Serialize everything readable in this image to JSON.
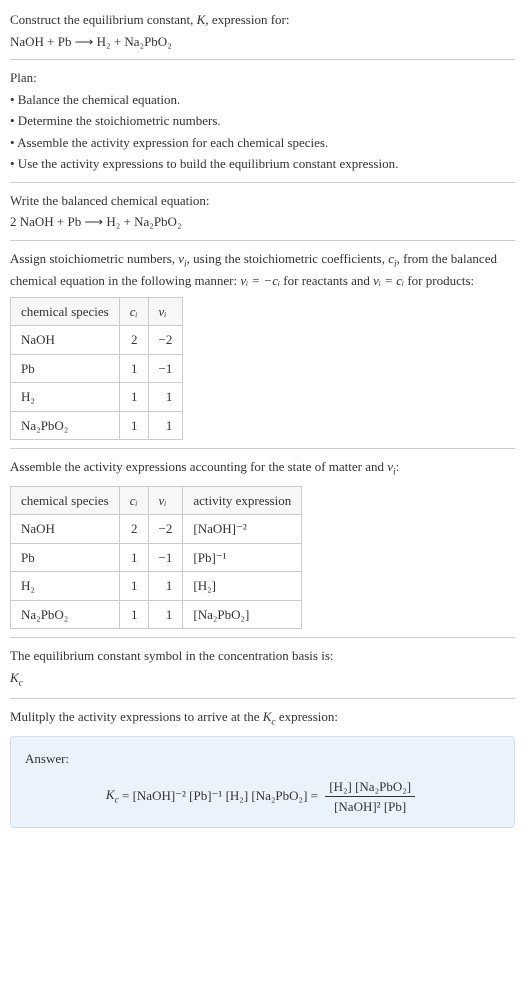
{
  "header": {
    "line1_prefix": "Construct the equilibrium constant, ",
    "line1_K": "K",
    "line1_suffix": ", expression for:",
    "equation": "NaOH + Pb  ⟶  H₂ + Na₂PbO₂"
  },
  "plan": {
    "title": "Plan:",
    "items": [
      "• Balance the chemical equation.",
      "• Determine the stoichiometric numbers.",
      "• Assemble the activity expression for each chemical species.",
      "• Use the activity expressions to build the equilibrium constant expression."
    ]
  },
  "balanced": {
    "title": "Write the balanced chemical equation:",
    "equation": "2 NaOH + Pb  ⟶  H₂ + Na₂PbO₂"
  },
  "stoich": {
    "intro_a": "Assign stoichiometric numbers, ",
    "nu_i": "ν",
    "intro_b": ", using the stoichiometric coefficients, ",
    "c_i": "c",
    "intro_c": ", from the balanced chemical equation in the following manner: ",
    "rel1": "νᵢ = −cᵢ",
    "intro_d": " for reactants and ",
    "rel2": "νᵢ = cᵢ",
    "intro_e": " for products:",
    "headers": [
      "chemical species",
      "cᵢ",
      "νᵢ"
    ],
    "rows": [
      {
        "species": "NaOH",
        "c": "2",
        "nu": "−2"
      },
      {
        "species": "Pb",
        "c": "1",
        "nu": "−1"
      },
      {
        "species": "H₂",
        "c": "1",
        "nu": "1"
      },
      {
        "species": "Na₂PbO₂",
        "c": "1",
        "nu": "1"
      }
    ]
  },
  "activity": {
    "intro_a": "Assemble the activity expressions accounting for the state of matter and ",
    "intro_b": ":",
    "headers": [
      "chemical species",
      "cᵢ",
      "νᵢ",
      "activity expression"
    ],
    "rows": [
      {
        "species": "NaOH",
        "c": "2",
        "nu": "−2",
        "expr": "[NaOH]⁻²"
      },
      {
        "species": "Pb",
        "c": "1",
        "nu": "−1",
        "expr": "[Pb]⁻¹"
      },
      {
        "species": "H₂",
        "c": "1",
        "nu": "1",
        "expr": "[H₂]"
      },
      {
        "species": "Na₂PbO₂",
        "c": "1",
        "nu": "1",
        "expr": "[Na₂PbO₂]"
      }
    ]
  },
  "symbol": {
    "intro": "The equilibrium constant symbol in the concentration basis is:",
    "Kc": "K",
    "sub": "c"
  },
  "multiply": {
    "intro_a": "Mulitply the activity expressions to arrive at the ",
    "intro_b": " expression:"
  },
  "answer": {
    "label": "Answer:",
    "lhs_K": "K",
    "lhs_sub": "c",
    "eq": " = ",
    "rhs1": "[NaOH]⁻² [Pb]⁻¹ [H₂] [Na₂PbO₂]",
    "eq2": " = ",
    "frac_num": "[H₂] [Na₂PbO₂]",
    "frac_den": "[NaOH]² [Pb]"
  }
}
